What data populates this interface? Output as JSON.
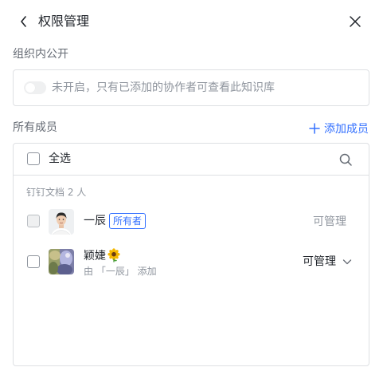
{
  "header": {
    "title": "权限管理",
    "back_icon": "chevron-left-icon",
    "close_icon": "close-icon"
  },
  "public_section": {
    "label": "组织内公开",
    "toggle_on": false,
    "description": "未开启，只有已添加的协作者可查看此知识库"
  },
  "members_section": {
    "label": "所有成员",
    "add_button_label": "添加成员",
    "select_all_label": "全选",
    "group_label": "钉钉文档 2 人",
    "members": [
      {
        "name": "一辰",
        "badge": "所有者",
        "permission": "可管理",
        "checkbox_enabled": false
      },
      {
        "name": "颖婕",
        "name_emoji": "sunflower",
        "added_by": "由 「一辰」 添加",
        "permission": "可管理",
        "checkbox_enabled": true
      }
    ]
  },
  "colors": {
    "accent": "#3370ff",
    "text_primary": "#1f2329",
    "text_secondary": "#646a73",
    "text_muted": "#8f959e",
    "border": "#dee0e3"
  }
}
